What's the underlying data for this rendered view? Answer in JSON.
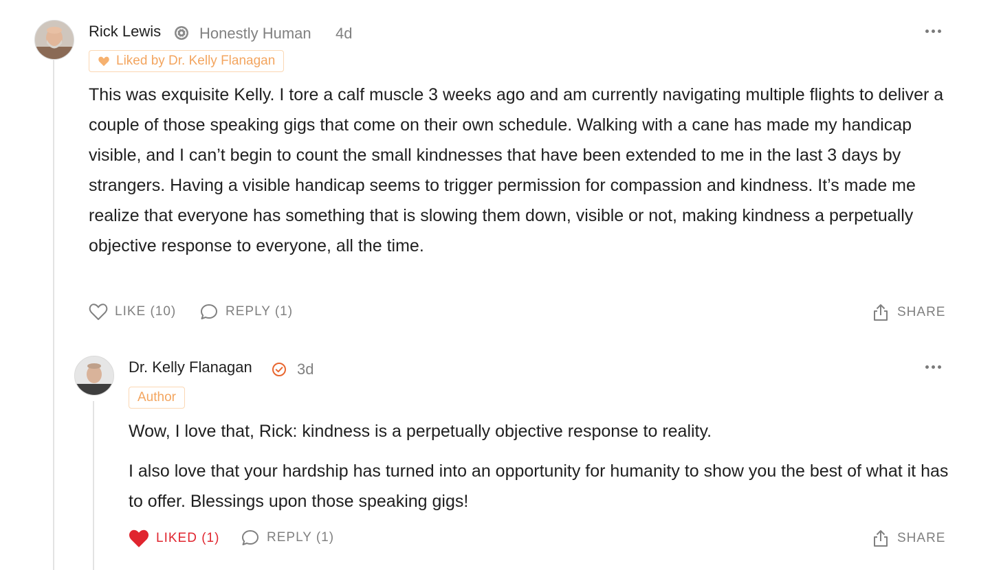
{
  "comments": [
    {
      "author": "Rick Lewis",
      "publication": "Honestly Human",
      "age": "4d",
      "liked_by": "Liked by Dr. Kelly Flanagan",
      "paragraphs": [
        "This was exquisite Kelly. I tore a calf muscle 3 weeks ago and am currently navigating multiple flights to deliver a couple of those speaking gigs that come on their own schedule. Walking with a cane has made my handicap visible, and I can’t begin to count the small kindnesses that have been extended to me in the last 3 days by strangers. Having a visible handicap seems to trigger permission for compassion and kindness. It’s made me realize that everyone has something that is slowing them down, visible or not, making kindness a perpetually objective response to everyone, all the time."
      ],
      "actions": {
        "like": "LIKE (10)",
        "reply": "REPLY (1)",
        "share": "SHARE"
      }
    },
    {
      "author": "Dr. Kelly Flanagan",
      "age": "3d",
      "role_badge": "Author",
      "paragraphs": [
        "Wow, I love that, Rick: kindness is a perpetually objective response to reality.",
        "I also love that your hardship has turned into an opportunity for humanity to show you the best of what it has to offer. Blessings upon those speaking gigs!"
      ],
      "actions": {
        "like": "LIKED (1)",
        "reply": "REPLY (1)",
        "share": "SHARE"
      }
    }
  ],
  "icons": {
    "publication_badge": "gear-badge-icon",
    "verified": "verified-check-icon",
    "heart_small": "heart-icon",
    "like": "heart-outline-icon",
    "liked": "heart-filled-icon",
    "reply": "speech-bubble-icon",
    "share": "share-icon",
    "more": "ellipsis-icon"
  },
  "colors": {
    "accent_orange": "#f3a55f",
    "verified_orange": "#e8662f",
    "liked_red": "#e0252f",
    "muted": "#808080"
  }
}
